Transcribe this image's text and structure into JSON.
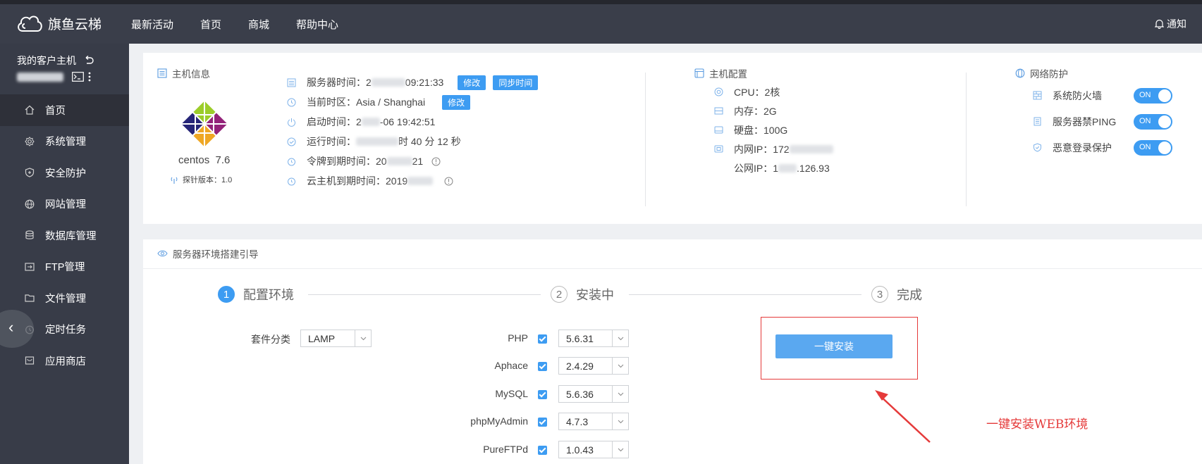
{
  "header": {
    "logo_text": "旗鱼云梯",
    "nav": [
      "最新活动",
      "首页",
      "商城",
      "帮助中心"
    ],
    "notify_label": "通知"
  },
  "sidebar": {
    "title": "我的客户主机",
    "items": [
      {
        "label": "首页",
        "icon": "home-icon"
      },
      {
        "label": "系统管理",
        "icon": "gear-icon"
      },
      {
        "label": "安全防护",
        "icon": "shield-icon"
      },
      {
        "label": "网站管理",
        "icon": "globe-icon"
      },
      {
        "label": "数据库管理",
        "icon": "database-icon"
      },
      {
        "label": "FTP管理",
        "icon": "ftp-icon"
      },
      {
        "label": "文件管理",
        "icon": "folder-icon"
      },
      {
        "label": "定时任务",
        "icon": "clock-icon"
      },
      {
        "label": "应用商店",
        "icon": "store-icon"
      }
    ]
  },
  "host_info": {
    "title": "主机信息",
    "os_name": "centos",
    "os_version": "7.6",
    "probe_label": "探针版本：1.0",
    "server_time_label": "服务器时间：2",
    "server_time_suffix": "09:21:33",
    "modify_label": "修改",
    "sync_label": "同步时间",
    "timezone_label": "当前时区：Asia / Shanghai",
    "tz_modify_label": "修改",
    "boot_time_label": "启动时间：2",
    "boot_time_suffix": "-06 19:42:51",
    "uptime_label": "运行时间：",
    "uptime_suffix": "时 40 分 12 秒",
    "token_expire_label": "令牌到期时间：20",
    "token_expire_suffix": "21",
    "cloud_expire_label": "云主机到期时间：2019"
  },
  "host_config": {
    "title": "主机配置",
    "cpu": "CPU：2核",
    "memory": "内存：2G",
    "disk": "硬盘：100G",
    "inner_ip": "内网IP：172",
    "public_ip_prefix": "公网IP：1",
    "public_ip_suffix": ".126.93"
  },
  "net_protect": {
    "title": "网络防护",
    "items": [
      {
        "label": "系统防火墙",
        "state": "ON"
      },
      {
        "label": "服务器禁PING",
        "state": "ON"
      },
      {
        "label": "恶意登录保护",
        "state": "ON"
      }
    ]
  },
  "guide": {
    "title": "服务器环境搭建引导",
    "steps": [
      {
        "num": "1",
        "label": "配置环境"
      },
      {
        "num": "2",
        "label": "安装中"
      },
      {
        "num": "3",
        "label": "完成"
      }
    ],
    "suite_label": "套件分类",
    "suite_value": "LAMP",
    "software": [
      {
        "name": "PHP",
        "version": "5.6.31"
      },
      {
        "name": "Aphace",
        "version": "2.4.29"
      },
      {
        "name": "MySQL",
        "version": "5.6.36"
      },
      {
        "name": "phpMyAdmin",
        "version": "4.7.3"
      },
      {
        "name": "PureFTPd",
        "version": "1.0.43"
      }
    ],
    "install_label": "一键安装",
    "annotation": "一键安装WEB环境"
  },
  "colors": {
    "accent": "#3d9cf2",
    "sidebar": "#383c48",
    "topbar": "#3a3e4a",
    "annotation": "#e53a3a"
  }
}
